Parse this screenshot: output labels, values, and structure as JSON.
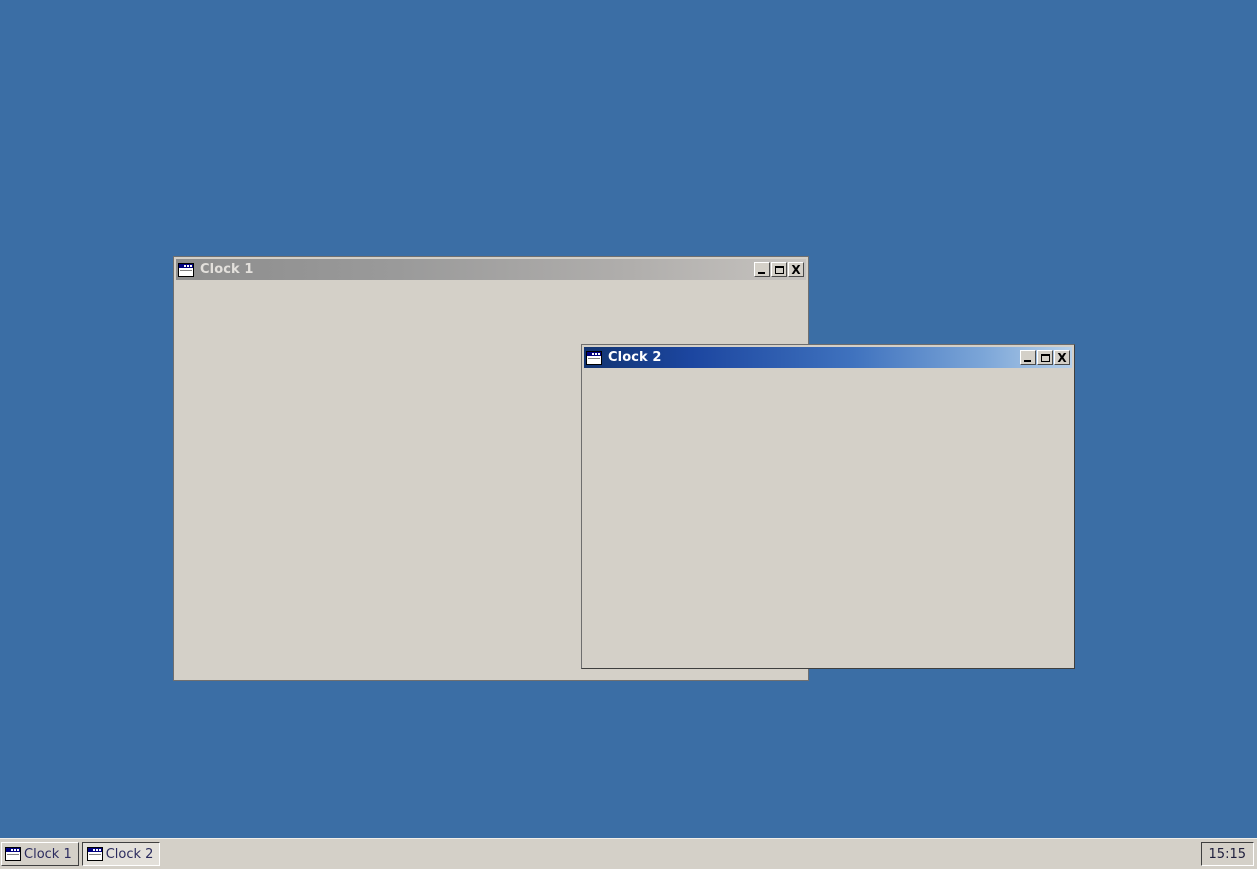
{
  "desktop": {
    "background_color": "#3b6ea5"
  },
  "windows": [
    {
      "id": "clock-1",
      "title": "Clock 1",
      "state": "inactive",
      "icon": "window-icon",
      "buttons": {
        "minimize": "_",
        "maximize": "□",
        "close": "X"
      },
      "titlebar_gradient_from": "#8d8d8d",
      "titlebar_gradient_to": "#c6c3bf",
      "client_background": "#d4d0c8"
    },
    {
      "id": "clock-2",
      "title": "Clock 2",
      "state": "active",
      "icon": "window-icon",
      "buttons": {
        "minimize": "_",
        "maximize": "□",
        "close": "X"
      },
      "titlebar_gradient_from": "#123471",
      "titlebar_gradient_to": "#b6d0ea",
      "client_background": "#d4d0c8"
    }
  ],
  "taskbar": {
    "background_color": "#d4d0c8",
    "buttons": [
      {
        "label": "Clock 1",
        "icon": "window-icon",
        "state": "raised"
      },
      {
        "label": "Clock 2",
        "icon": "window-icon",
        "state": "pressed"
      }
    ],
    "tray": {
      "clock": "15:15"
    }
  }
}
